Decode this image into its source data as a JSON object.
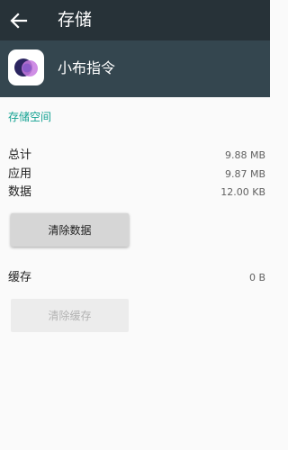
{
  "toolbar": {
    "back_icon": "arrow-left-icon",
    "title": "存储"
  },
  "app": {
    "icon": "xiaobu-app-icon",
    "name": "小布指令"
  },
  "storage": {
    "section_title": "存储空间",
    "rows": [
      {
        "label": "总计",
        "value": "9.88 MB"
      },
      {
        "label": "应用",
        "value": "9.87 MB"
      },
      {
        "label": "数据",
        "value": "12.00 KB"
      }
    ],
    "clear_data_label": "清除数据"
  },
  "cache": {
    "label": "缓存",
    "value": "0 B",
    "clear_cache_label": "清除缓存"
  },
  "colors": {
    "toolbar": "#273238",
    "app_header": "#34464f",
    "accent": "#11a191"
  }
}
